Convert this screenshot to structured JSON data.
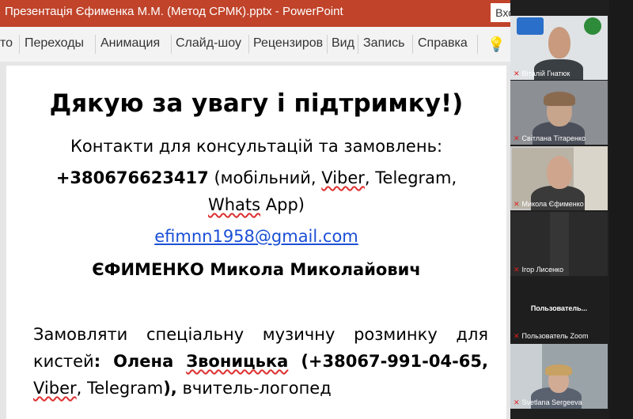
{
  "titlebar": {
    "title": "Презентація Єфименка М.М. (Метод СРМК).pptx  -  PowerPoint",
    "sign_in": "Вход",
    "min_icon": "minimize-icon",
    "restore_icon": "restore-icon"
  },
  "ribbon": {
    "tabs": [
      "то",
      "Переходы",
      "Анимация",
      "Слайд-шоу",
      "Рецензиров",
      "Вид",
      "Запись",
      "Справка"
    ],
    "help_icon": "lightbulb-icon"
  },
  "slide": {
    "title": "Дякую за увагу і підтримку!)",
    "contacts_label": "Контакти для консультацій та замовлень:",
    "phone": "+380676623417",
    "phone_suffix_1": " (мобільний, ",
    "viber": "Viber",
    "phone_suffix_2": ", Telegram,",
    "whats": "Whats",
    "whats_suffix": " App)",
    "email": "efimnn1958@gmail.com",
    "name": "ЄФИМЕНКО  Микола Миколайович",
    "para_1": "Замовляти спеціальну музичну розминку для кистей",
    "para_colon": ": ",
    "para_name_bold_1": "Олена ",
    "para_name_bold_2": "Звоницька",
    "para_phone_bold": " (+38067-991-04-65, ",
    "para_viber": "Viber",
    "para_telegram": ", Telegram",
    "para_close_bold": "),",
    "para_end": " вчитель-логопед"
  },
  "participants": [
    {
      "name": "Віталій Гнатюк"
    },
    {
      "name": "Світлана Тітаренко"
    },
    {
      "name": "Микола Єфименко"
    },
    {
      "name": "Ігор Лисенко"
    },
    {
      "name": "Пользователь Zoom",
      "center_label": "Пользователь..."
    },
    {
      "name": "Svetlana Sergeeva"
    }
  ],
  "colors": {
    "titlebar": "#c0432a",
    "link": "#1a4fd6",
    "mic_muted": "#e02020"
  }
}
